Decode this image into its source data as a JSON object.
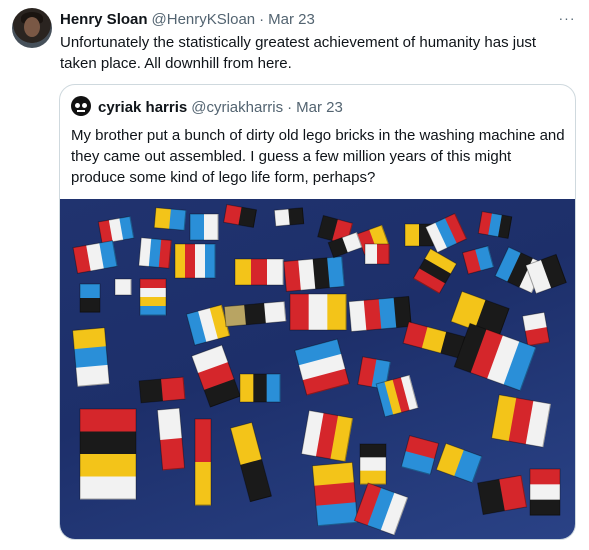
{
  "tweet": {
    "author_name": "Henry Sloan",
    "author_handle": "@HenryKSloan",
    "separator": "·",
    "date": "Mar 23",
    "more_label": "···",
    "text": "Unfortunately the statistically greatest achievement of humanity has just taken place. All downhill from here."
  },
  "quoted_tweet": {
    "author_name": "cyriak harris",
    "author_handle": "@cyriakharris",
    "separator": "·",
    "date": "Mar 23",
    "text": "My brother put a bunch of dirty old lego bricks in the washing machine and they came out assembled. I guess a few million years of this might produce some kind of lego life form, perhaps?"
  },
  "media": {
    "subject": "lego-bricks-on-blue-towel",
    "colors": {
      "towel": "#1f3270",
      "red": "#d5262b",
      "yellow": "#f3c419",
      "blue": "#2a8fd8",
      "white": "#f2f2f2",
      "black": "#1a1a1a",
      "tan": "#b8a463"
    }
  }
}
